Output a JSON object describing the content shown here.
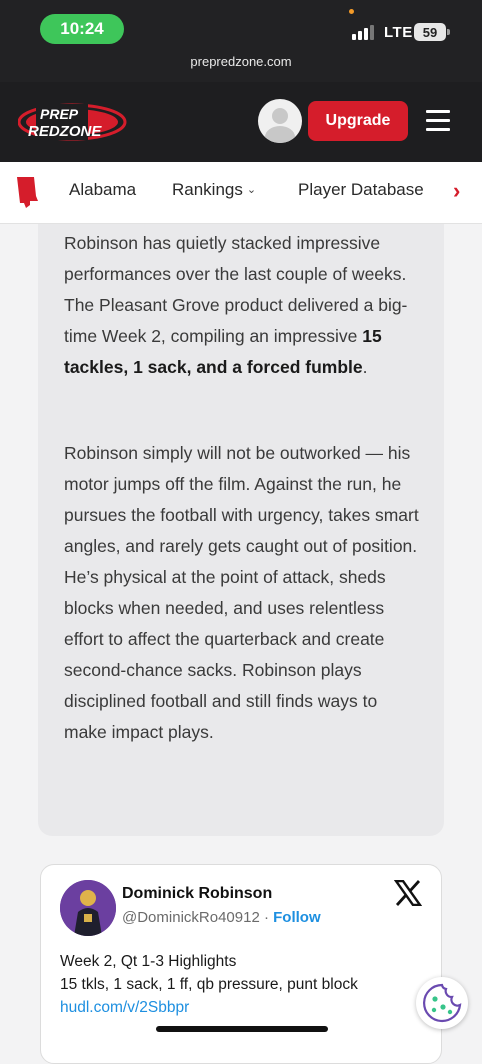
{
  "status_bar": {
    "time": "10:24",
    "network": "LTE",
    "battery": "59",
    "url": "prepredzone.com"
  },
  "header": {
    "logo_line1": "PREP",
    "logo_line2": "REDZONE",
    "upgrade_label": "Upgrade",
    "brand_color": "#d51d2b"
  },
  "subnav": {
    "items": [
      {
        "label": "Alabama"
      },
      {
        "label": "Rankings"
      },
      {
        "label": "Player Database"
      }
    ],
    "state_icon": "alabama-state-icon",
    "next_icon": "chevron-right-icon"
  },
  "article": {
    "p1_before": "Robinson has quietly stacked impressive performances over the last couple of weeks. The Pleasant Grove product delivered a big-time Week 2, compiling an impressive ",
    "p1_bold": "15 tackles, 1 sack, and a forced fumble",
    "p1_after": ".",
    "p2": "Robinson simply will not be outworked — his motor jumps off the film. Against the run, he pursues the football with urgency, takes smart angles, and rarely gets caught out of position. He’s physical at the point of attack, sheds blocks when needed, and uses relentless effort to affect the quarterback and create second-chance sacks. Robinson plays disciplined football and still finds ways to make impact plays."
  },
  "tweet": {
    "name": "Dominick Robinson",
    "handle": "@DominickRo40912",
    "separator": "·",
    "follow_label": "Follow",
    "line1": "Week 2, Qt 1-3 Highlights",
    "line2": "15 tkls, 1 sack, 1 ff, qb pressure, punt block",
    "link": "hudl.com/v/2Sbbpr",
    "platform_icon": "x-logo-icon"
  }
}
